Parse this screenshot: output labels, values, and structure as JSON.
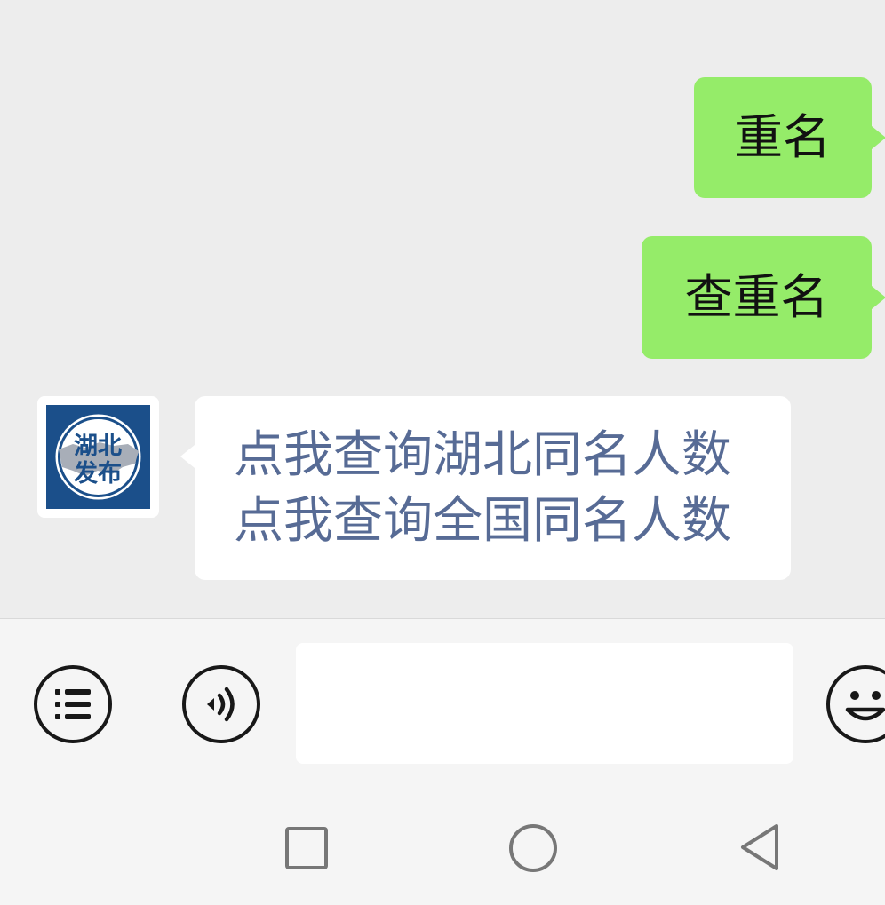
{
  "messages": {
    "outgoing": [
      {
        "text": "重名"
      },
      {
        "text": "查重名"
      }
    ],
    "incoming": {
      "avatar_text": [
        "湖北",
        "发布"
      ],
      "avatar_colors": {
        "frame": "#1b4f8a",
        "disc": "#ffffff",
        "map": "#a8aeb8"
      },
      "links": [
        "点我查询湖北同名人数",
        "点我查询全国同名人数"
      ]
    }
  },
  "input_bar": {
    "menu_icon": "list-icon",
    "voice_icon": "voice-icon",
    "emoji_icon": "smiley-icon",
    "input_value": "",
    "input_placeholder": ""
  },
  "nav_bar": {
    "recent_icon": "square-icon",
    "home_icon": "circle-icon",
    "back_icon": "triangle-back-icon"
  },
  "colors": {
    "chat_bg": "#ededed",
    "outgoing_bubble": "#95ec69",
    "incoming_bubble": "#ffffff",
    "link_text": "#576b95",
    "input_bar_bg": "#f5f5f5"
  }
}
